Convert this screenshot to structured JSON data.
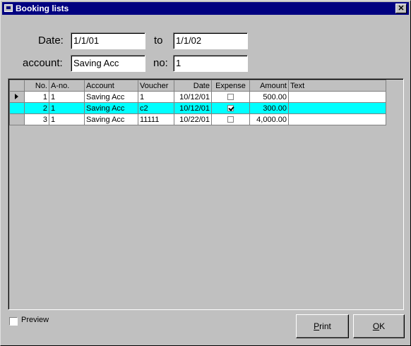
{
  "window": {
    "title": "Booking lists",
    "close_glyph": "✕"
  },
  "filters": {
    "date_label": "Date:",
    "date_from": "1/1/01",
    "to_label": "to",
    "date_to": "1/1/02",
    "account_label": "account:",
    "account_value": "Saving Acc",
    "no_label": "no:",
    "no_value": "1"
  },
  "grid": {
    "columns": [
      "No.",
      "A-no.",
      "Account",
      "Voucher",
      "Date",
      "Expense",
      "Amount",
      "Text"
    ],
    "rows": [
      {
        "no": "1",
        "ano": "1",
        "account": "Saving Acc",
        "voucher": "1",
        "date": "10/12/01",
        "expense": false,
        "amount": "500.00",
        "text": ""
      },
      {
        "no": "2",
        "ano": "1",
        "account": "Saving Acc",
        "voucher": "c2",
        "date": "10/12/01",
        "expense": true,
        "amount": "300.00",
        "text": ""
      },
      {
        "no": "3",
        "ano": "1",
        "account": "Saving Acc",
        "voucher": "11111",
        "date": "10/22/01",
        "expense": false,
        "amount": "4,000.00",
        "text": ""
      }
    ],
    "selected_row": 1,
    "selection_color": "#00ffff"
  },
  "footer": {
    "preview_label": "Preview",
    "preview_checked": false,
    "print_label_first": "P",
    "print_label_rest": "rint",
    "ok_label_first": "O",
    "ok_label_rest": "K"
  }
}
